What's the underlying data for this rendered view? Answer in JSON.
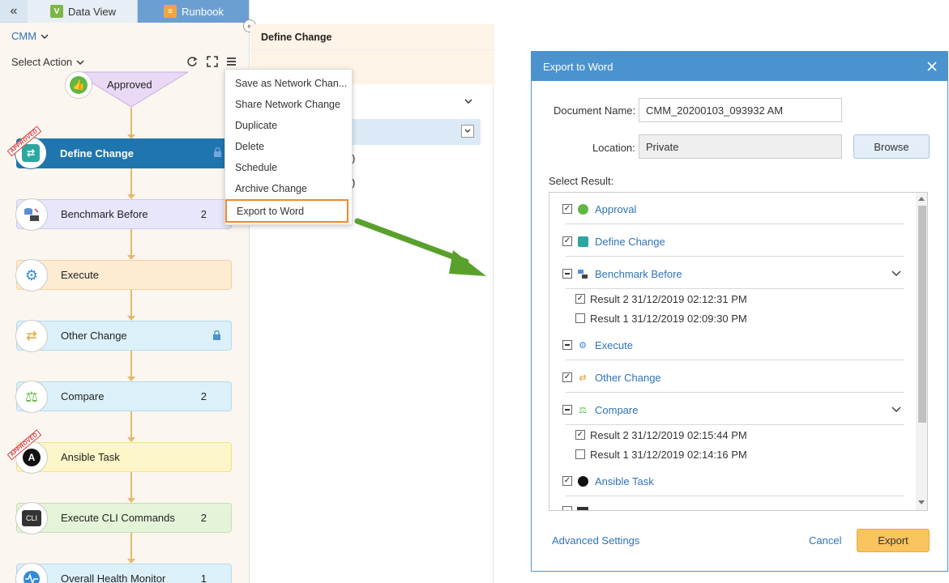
{
  "tabs": {
    "collapse": "«",
    "data_view": "Data View",
    "runbook": "Runbook"
  },
  "runbook": {
    "name": "CMM",
    "select_action": "Select Action",
    "nodes": [
      {
        "label": "Approved",
        "count": ""
      },
      {
        "label": "Define Change",
        "count": ""
      },
      {
        "label": "Benchmark Before",
        "count": "2"
      },
      {
        "label": "Execute",
        "count": ""
      },
      {
        "label": "Other Change",
        "count": ""
      },
      {
        "label": "Compare",
        "count": "2"
      },
      {
        "label": "Ansible Task",
        "count": ""
      },
      {
        "label": "Execute CLI Commands",
        "count": "2"
      },
      {
        "label": "Overall Health Monitor",
        "count": "1"
      }
    ],
    "stamp": "APPROVED",
    "cli_icon": "CLI"
  },
  "context_menu": {
    "items": [
      "Save as Network Chan...",
      "Share Network Change",
      "Duplicate",
      "Delete",
      "Schedule",
      "Archive Change",
      "Export to Word"
    ]
  },
  "middle": {
    "title": "Define Change",
    "paren1": ")",
    "paren2": ")"
  },
  "dialog": {
    "title": "Export to Word",
    "doc_name_label": "Document Name:",
    "doc_name_value": "CMM_20200103_093932 AM",
    "location_label": "Location:",
    "location_value": "Private",
    "browse": "Browse",
    "select_result": "Select Result:",
    "results": [
      {
        "label": "Approval",
        "state": "checked"
      },
      {
        "label": "Define Change",
        "state": "checked"
      },
      {
        "label": "Benchmark Before",
        "state": "partial"
      },
      {
        "label": "Result 2 31/12/2019 02:12:31 PM",
        "state": "checked"
      },
      {
        "label": "Result 1 31/12/2019 02:09:30 PM",
        "state": "unchecked"
      },
      {
        "label": "Execute",
        "state": "partial"
      },
      {
        "label": "Other Change",
        "state": "checked"
      },
      {
        "label": "Compare",
        "state": "partial"
      },
      {
        "label": "Result 2 31/12/2019 02:15:44 PM",
        "state": "checked"
      },
      {
        "label": "Result 1 31/12/2019 02:14:16 PM",
        "state": "unchecked"
      },
      {
        "label": "Ansible Task",
        "state": "checked"
      }
    ],
    "advanced_settings": "Advanced Settings",
    "cancel": "Cancel",
    "export": "Export"
  },
  "colors": {
    "accent": "#4b93cf",
    "highlight_border": "#f0882e",
    "arrow": "#5aa02c",
    "export_button": "#f9c35d"
  }
}
